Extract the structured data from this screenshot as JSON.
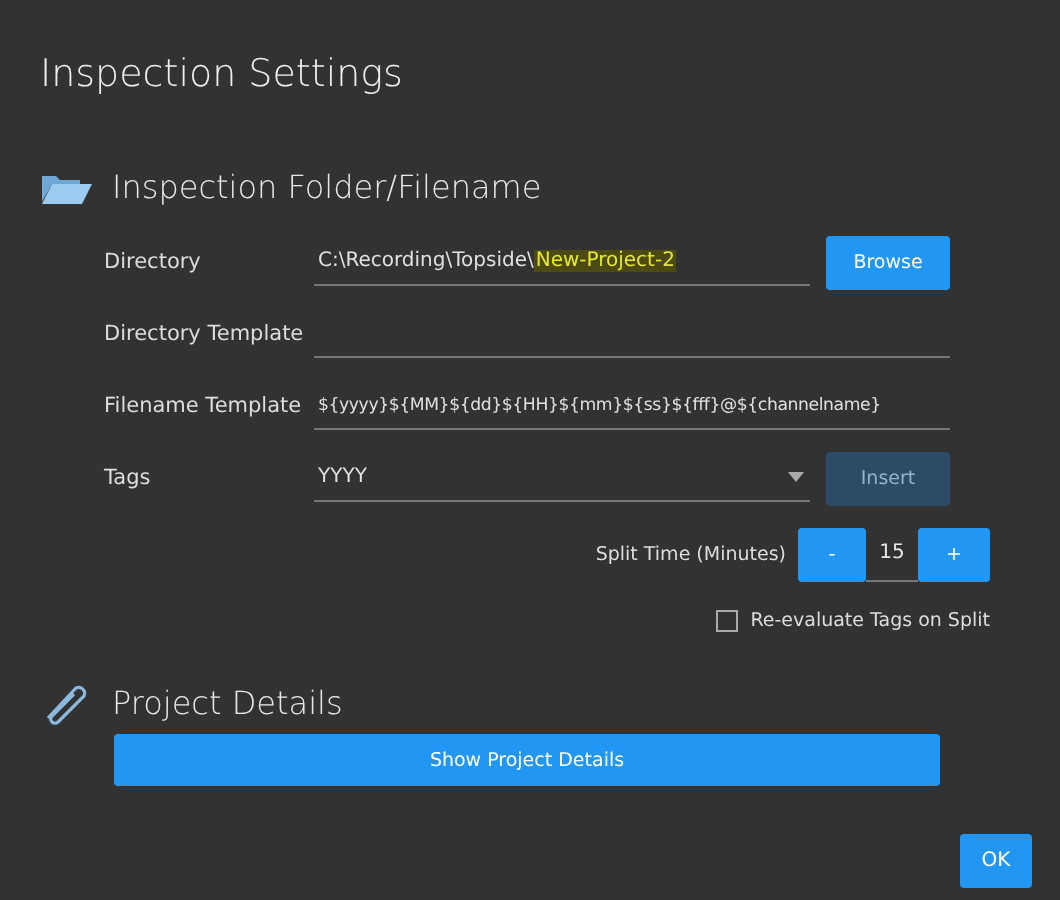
{
  "window": {
    "title": "Inspection Settings"
  },
  "folder_section": {
    "title": "Inspection Folder/Filename",
    "directory": {
      "label": "Directory",
      "value": "C:\\Recording\\Topside\\",
      "highlighted": "New-Project-2",
      "button": "Browse"
    },
    "directory_template": {
      "label": "Directory Template"
    },
    "filename_template": {
      "label": "Filename Template",
      "value": "${yyyy}${MM}${dd}${HH}${mm}${ss}${fff}@${channelname}"
    },
    "tags": {
      "label": "Tags",
      "value": "YYYY",
      "button": "Insert",
      "button_disabled": true
    },
    "split_time": {
      "label": "Split Time (Minutes)",
      "minus": "-",
      "value": "15",
      "plus": "+"
    },
    "reevaluate": {
      "label": "Re-evaluate Tags on Split",
      "checked": false
    }
  },
  "project_section": {
    "title": "Project Details",
    "button": "Show Project Details"
  },
  "buttons": [
    "OK"
  ]
}
